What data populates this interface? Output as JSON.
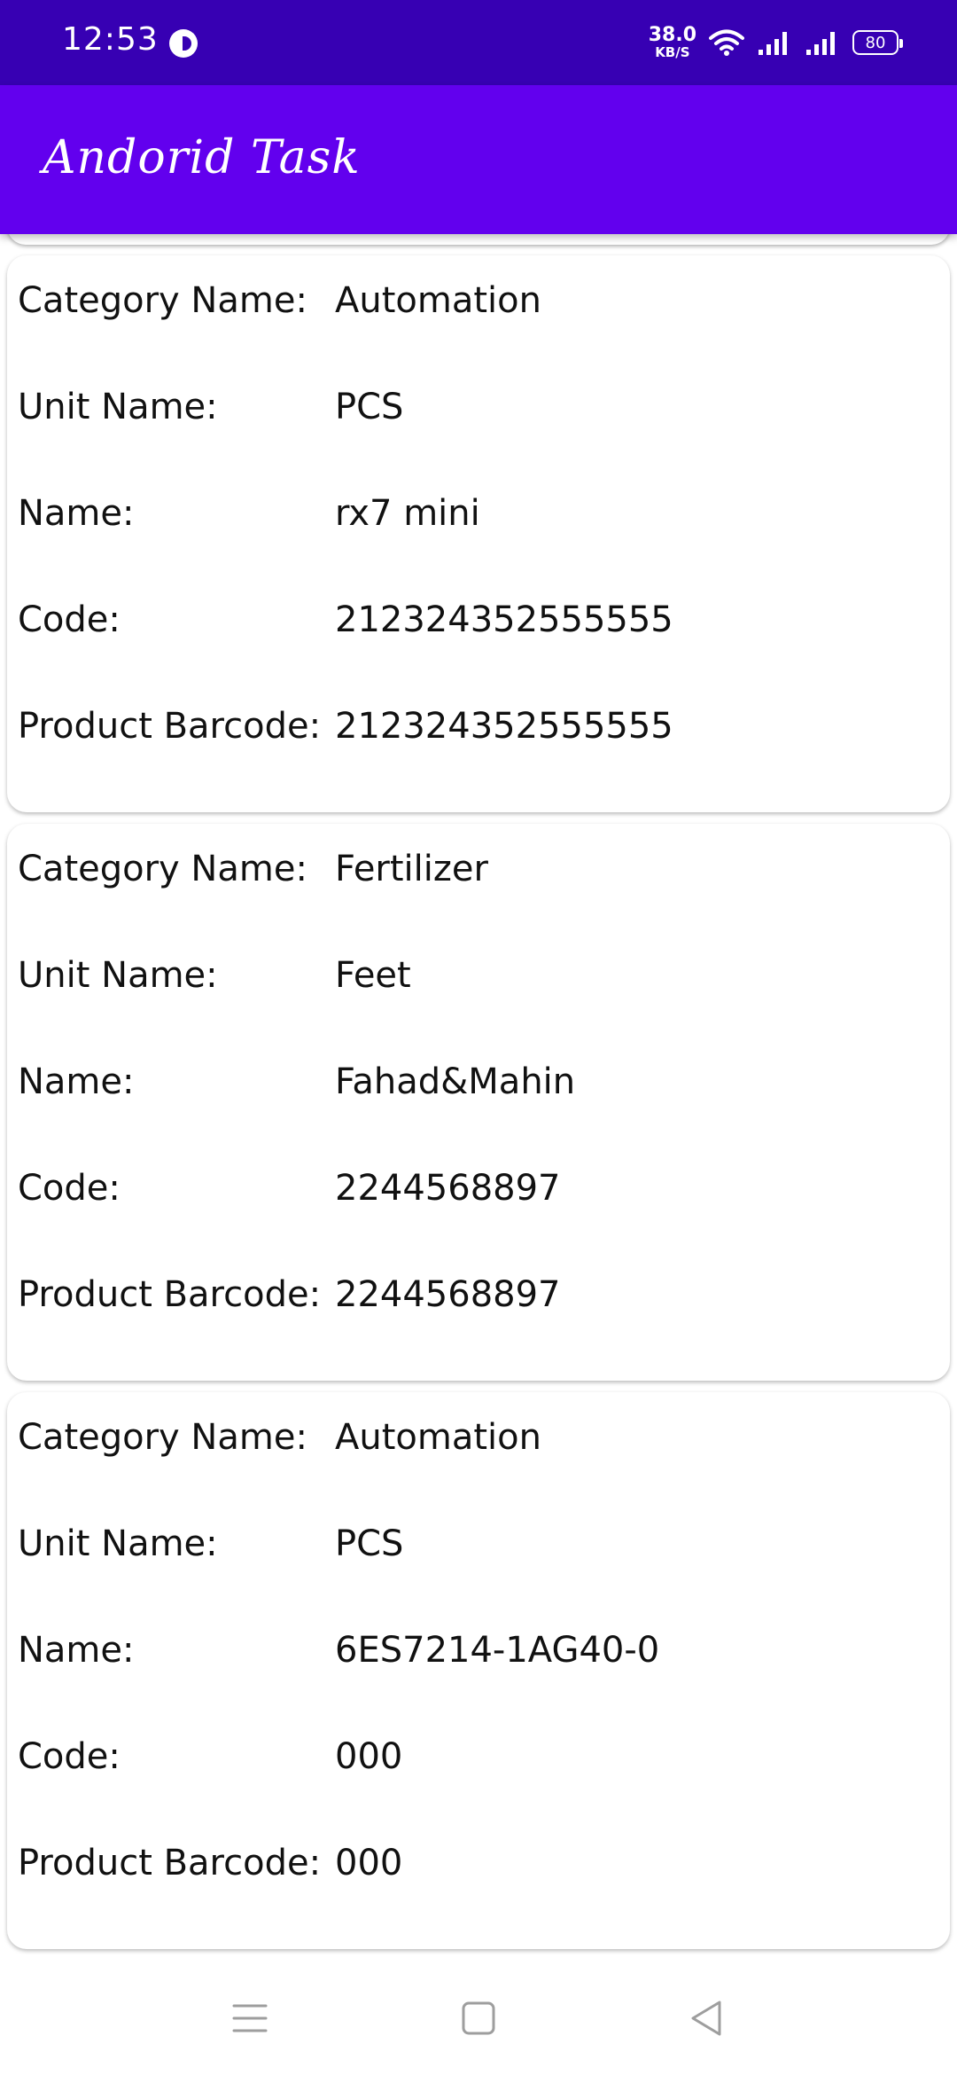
{
  "status_bar": {
    "time": "12:53",
    "net_speed_value": "38.0",
    "net_speed_unit": "KB/S",
    "battery": "80"
  },
  "app_bar": {
    "title": "Andorid Task"
  },
  "products": [
    {
      "category_label": "Category Name:",
      "category": "Automation",
      "unit_label": "Unit Name:",
      "unit": "PCS",
      "name_label": "Name:",
      "name": "rx7 mini",
      "code_label": "Code:",
      "code": "212324352555555",
      "barcode_label": "Product Barcode:",
      "barcode": "212324352555555"
    },
    {
      "category_label": "Category Name:",
      "category": "Fertilizer",
      "unit_label": "Unit Name:",
      "unit": "Feet",
      "name_label": "Name:",
      "name": "Fahad&Mahin",
      "code_label": "Code:",
      "code": "2244568897",
      "barcode_label": "Product Barcode:",
      "barcode": "2244568897"
    },
    {
      "category_label": "Category Name:",
      "category": "Automation",
      "unit_label": "Unit Name:",
      "unit": "PCS",
      "name_label": "Name:",
      "name": "6ES7214-1AG40-0",
      "code_label": "Code:",
      "code": "000",
      "barcode_label": "Product Barcode:",
      "barcode": "000"
    }
  ],
  "nav_bar": {
    "icons": [
      "menu-icon",
      "home-square-icon",
      "back-triangle-icon"
    ]
  },
  "colors": {
    "status_bar": "#3700b3",
    "app_bar": "#6200ee"
  }
}
